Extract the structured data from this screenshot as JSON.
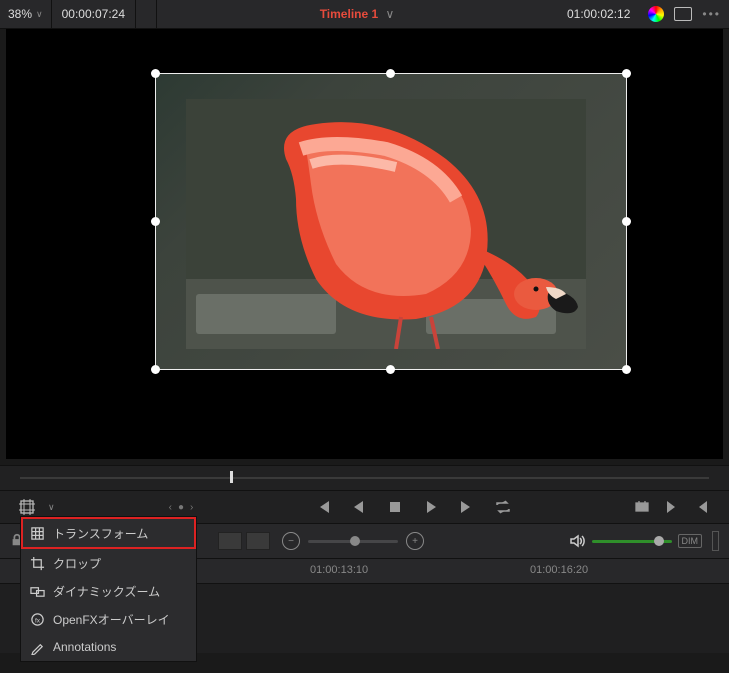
{
  "topbar": {
    "zoom": "38%",
    "timecode_in": "00:00:07:24",
    "title": "Timeline 1",
    "timecode_out": "01:00:02:12"
  },
  "transport": {
    "nav_prev": "‹",
    "nav_dot": "●",
    "nav_next": "›"
  },
  "toolbar": {
    "dim_label": "DIM"
  },
  "ruler": {
    "t1": "01:00:13:10",
    "t2": "01:00:16:20"
  },
  "menu": {
    "transform": "トランスフォーム",
    "crop": "クロップ",
    "dynamic_zoom": "ダイナミックズーム",
    "openfx": "OpenFXオーバーレイ",
    "annotations": "Annotations"
  }
}
